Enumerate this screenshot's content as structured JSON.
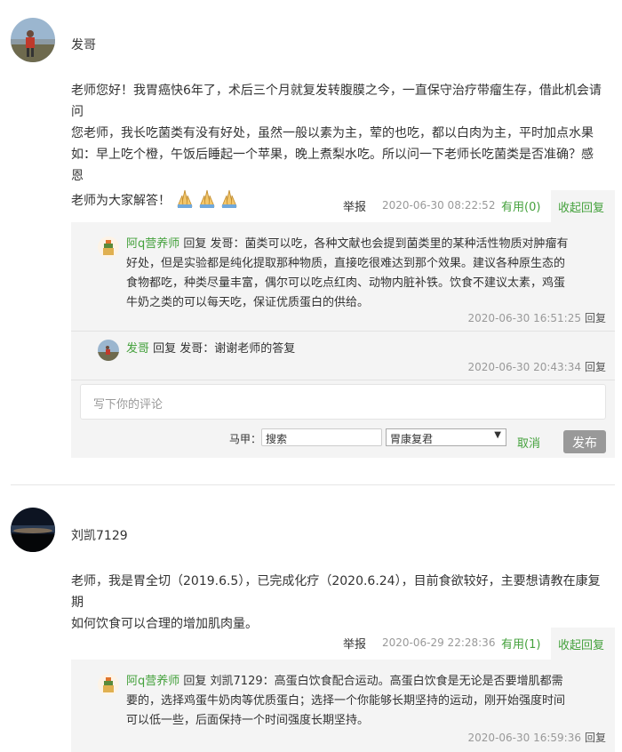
{
  "posts": [
    {
      "username": "发哥",
      "content_line1": "老师您好！我胃癌快6年了，术后三个月就复发转腹膜之今，一直保守治疗带瘤生存，借此机会请问",
      "content_line2": "您老师，我长吃菌类有没有好处，虽然一般以素为主，荤的也吃，都以白肉为主，平时加点水果",
      "content_line3": "如：早上吃个橙，午饭后睡起一个苹果，晚上煮梨水吃。所以问一下老师长吃菌类是否准确？感恩",
      "content_line4": "老师为大家解答！",
      "report": "举报",
      "time": "2020-06-30 08:22:52",
      "useful": "有用(0)",
      "collapse": "收起回复",
      "replies": [
        {
          "name": "阿q营养师",
          "action": "回复 发哥：",
          "text1": "菌类可以吃，各种文献也会提到菌类里的某种活性物质对肿瘤有",
          "text2": "好处，但是实验都是纯化提取那种物质，直接吃很难达到那个效果。建议各种原生态的",
          "text3": "食物都吃，种类尽量丰富，偶尔可以吃点红肉、动物内脏补铁。饮食不建议太素，鸡蛋",
          "text4": "牛奶之类的可以每天吃，保证优质蛋白的供给。",
          "time": "2020-06-30 16:51:25",
          "reply": "回复"
        },
        {
          "name": "发哥",
          "action": "回复 发哥：",
          "text1": "谢谢老师的答复",
          "time": "2020-06-30 20:43:34",
          "reply": "回复"
        }
      ],
      "comment_placeholder": "写下你的评论",
      "majia_label": "马甲：",
      "search_placeholder": "搜索",
      "select_value": "胃康复君",
      "cancel": "取消",
      "publish": "发布"
    },
    {
      "username": "刘凯7129",
      "content_line1": "老师，我是胃全切（2019.6.5），已完成化疗（2020.6.24），目前食欲较好，主要想请教在康复期",
      "content_line2": "如何饮食可以合理的增加肌肉量。",
      "report": "举报",
      "time": "2020-06-29 22:28:36",
      "useful": "有用(1)",
      "collapse": "收起回复",
      "replies": [
        {
          "name": "阿q营养师",
          "action": "回复 刘凯7129：",
          "text1": "高蛋白饮食配合运动。高蛋白饮食是无论是否要增肌都需",
          "text2": "要的，选择鸡蛋牛奶肉等优质蛋白；选择一个你能够长期坚持的运动，刚开始强度时间",
          "text3": "可以低一些，后面保持一个时间强度长期坚持。",
          "time": "2020-06-30 16:59:36",
          "reply": "回复"
        }
      ]
    }
  ],
  "colors": {
    "accent": "#44a13c",
    "muted": "#999999",
    "panel": "#f4f4f4"
  }
}
